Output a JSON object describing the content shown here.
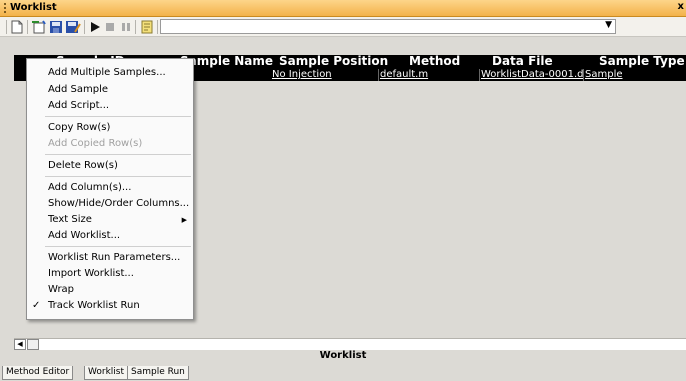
{
  "window": {
    "title": "Worklist",
    "close_glyph": "x"
  },
  "toolbar": {
    "icons": [
      "new-file-icon",
      "import-icon",
      "save-icon",
      "save-as-icon",
      "run-icon",
      "stop-icon",
      "pause-icon",
      "method-icon"
    ],
    "combo_value": ""
  },
  "grid": {
    "hidden_left_header": "Sample ID",
    "headers": [
      "Sample Name",
      "Sample Position",
      "Method",
      "Data File",
      "Sample Type"
    ],
    "rows": [
      {
        "sample_position": "No Injection",
        "method": "default.m",
        "data_file": "WorklistData-0001.d",
        "sample_type": "Sample"
      }
    ]
  },
  "context_menu": {
    "items": [
      {
        "label": "Add Multiple Samples...",
        "enabled": true
      },
      {
        "label": "Add Sample",
        "enabled": true
      },
      {
        "label": "Add Script...",
        "enabled": true
      },
      {
        "label": "Copy Row(s)",
        "enabled": true
      },
      {
        "label": "Add Copied Row(s)",
        "enabled": false
      },
      {
        "label": "Delete Row(s)",
        "enabled": true
      },
      {
        "label": "Add Column(s)...",
        "enabled": true
      },
      {
        "label": "Show/Hide/Order Columns...",
        "enabled": true
      },
      {
        "label": "Text Size",
        "enabled": true,
        "submenu": true
      },
      {
        "label": "Add Worklist...",
        "enabled": true
      },
      {
        "label": "Worklist Run Parameters...",
        "enabled": true
      },
      {
        "label": "Import Worklist...",
        "enabled": true
      },
      {
        "label": "Wrap",
        "enabled": true
      },
      {
        "label": "Track Worklist Run",
        "enabled": true,
        "checked": true
      }
    ]
  },
  "footer": {
    "title": "Worklist"
  },
  "tabs": [
    "Method Editor",
    "Worklist",
    "Sample Run"
  ],
  "colors": {
    "title_bar": "#f3b24a",
    "grid_header": "#000000",
    "background": "#dcdad5"
  }
}
